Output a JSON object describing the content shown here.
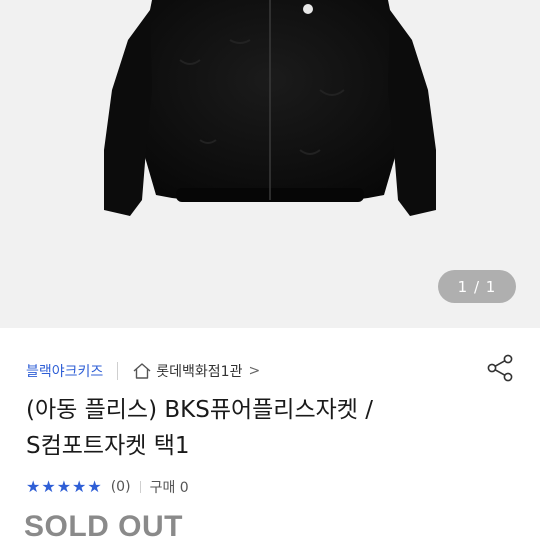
{
  "gallery": {
    "pager_text": "1 / 1",
    "image_icon": "jacket-image"
  },
  "product": {
    "brand": "블랙야크키즈",
    "store": "롯데백화점1관",
    "store_icon": "home-icon",
    "store_chevron": ">",
    "title_line1": "(아동 플리스) BKS퓨어플리스자켓 /",
    "title_line2": "S컴포트자켓 택1",
    "rating_stars": 5,
    "review_count": "(0)",
    "purchase_text": "구매 0",
    "status": "SOLD OUT"
  },
  "colors": {
    "accent": "#2f5fd6",
    "soldout": "#8a8a8a",
    "hero_bg": "#f1f1f1"
  }
}
